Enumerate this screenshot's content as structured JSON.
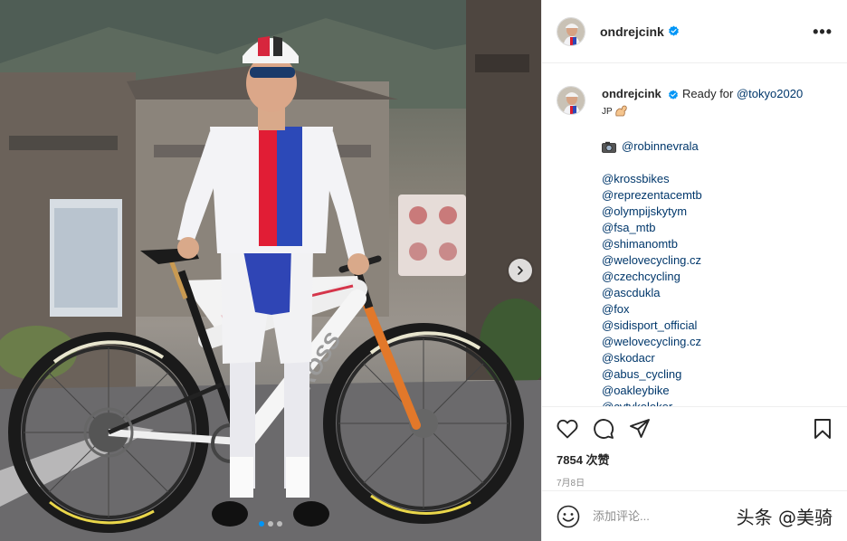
{
  "post": {
    "username": "ondrejcink",
    "caption": {
      "username": "ondrejcink",
      "text": "Ready for ",
      "mention": "@tokyo2020",
      "jp_line": "JP",
      "photo_credit": "@robinnevrala",
      "tags": [
        "@krossbikes",
        "@reprezentacemtb",
        "@olympijskytym",
        "@fsa_mtb",
        "@shimanomtb",
        "@welovecycling.cz",
        "@czechcycling",
        "@ascdukla",
        "@fox",
        "@sidisport_official",
        "@welovecycling.cz",
        "@skodacr",
        "@abus_cycling",
        "@oakleybike",
        "@cytykoloker"
      ]
    },
    "likes": "7854 次赞",
    "date": "7月8日",
    "comment_placeholder": "添加评论...",
    "more_label": "•••"
  },
  "watermark": "头条 @美骑",
  "carousel": {
    "slides": 3,
    "active": 0
  },
  "icons": {
    "verified": "verified-badge-icon",
    "like": "heart-icon",
    "comment": "comment-bubble-icon",
    "share": "paper-plane-icon",
    "save": "bookmark-icon",
    "emoji": "smiley-icon",
    "camera": "camera-emoji-icon",
    "arm": "flexed-arm-emoji-icon",
    "next": "chevron-right-icon"
  },
  "colors": {
    "verified": "#0095f6",
    "mention": "#00376b",
    "secondary_text": "#8e8e8e",
    "border": "#efefef"
  }
}
